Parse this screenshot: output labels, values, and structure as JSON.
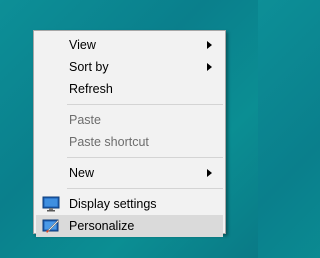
{
  "desktop": {
    "background_color": "#0b8792"
  },
  "context_menu": {
    "items": [
      {
        "label": "View",
        "has_submenu": true,
        "disabled": false
      },
      {
        "label": "Sort by",
        "has_submenu": true,
        "disabled": false
      },
      {
        "label": "Refresh",
        "has_submenu": false,
        "disabled": false
      },
      {
        "label": "Paste",
        "has_submenu": false,
        "disabled": true
      },
      {
        "label": "Paste shortcut",
        "has_submenu": false,
        "disabled": true
      },
      {
        "label": "New",
        "has_submenu": true,
        "disabled": false
      },
      {
        "label": "Display settings",
        "has_submenu": false,
        "disabled": false,
        "icon": "display-settings-icon"
      },
      {
        "label": "Personalize",
        "has_submenu": false,
        "disabled": false,
        "icon": "personalize-icon",
        "highlighted": true
      }
    ]
  }
}
